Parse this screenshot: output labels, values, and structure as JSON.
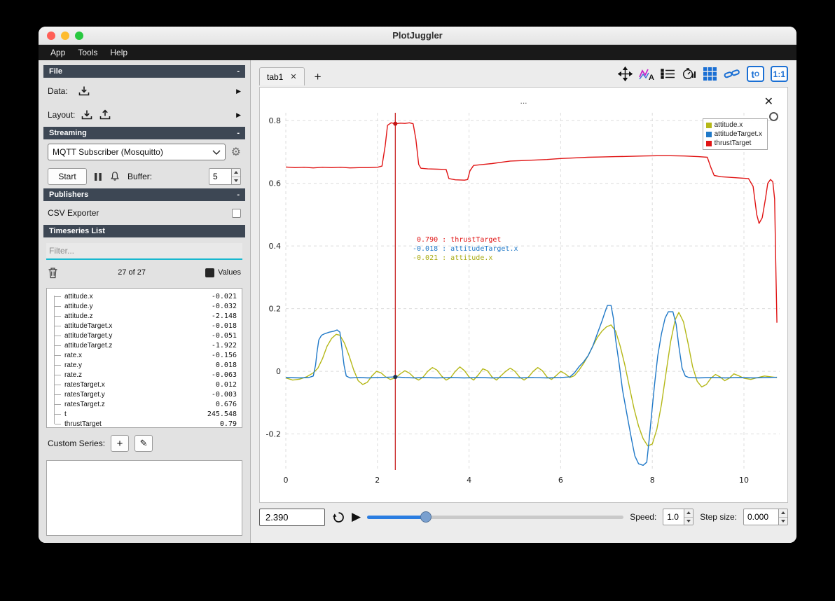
{
  "window": {
    "title": "PlotJuggler",
    "menu": [
      "App",
      "Tools",
      "Help"
    ]
  },
  "glyphs": {
    "arrow_right": "▶",
    "play": "▶",
    "plus": "+",
    "pencil": "✎",
    "gear": "⚙",
    "close": "✕",
    "collapse": "-"
  },
  "sidebar": {
    "file": {
      "header": "File",
      "collapse": "-",
      "data_label": "Data:",
      "layout_label": "Layout:"
    },
    "streaming": {
      "header": "Streaming",
      "collapse": "-",
      "source_selected": "MQTT Subscriber (Mosquitto)",
      "start_label": "Start",
      "buffer_label": "Buffer:",
      "buffer_value": "5"
    },
    "publishers": {
      "header": "Publishers",
      "collapse": "-",
      "csv_exporter_label": "CSV Exporter"
    },
    "timeseries": {
      "header": "Timeseries List",
      "filter_placeholder": "Filter...",
      "count": "27 of 27",
      "values_label": "Values",
      "items": [
        {
          "name": "attitude.x",
          "value": "-0.021"
        },
        {
          "name": "attitude.y",
          "value": "-0.032"
        },
        {
          "name": "attitude.z",
          "value": "-2.148"
        },
        {
          "name": "attitudeTarget.x",
          "value": "-0.018"
        },
        {
          "name": "attitudeTarget.y",
          "value": "-0.051"
        },
        {
          "name": "attitudeTarget.z",
          "value": "-1.922"
        },
        {
          "name": "rate.x",
          "value": "-0.156"
        },
        {
          "name": "rate.y",
          "value": "0.018"
        },
        {
          "name": "rate.z",
          "value": "-0.063"
        },
        {
          "name": "ratesTarget.x",
          "value": "0.012"
        },
        {
          "name": "ratesTarget.y",
          "value": "-0.003"
        },
        {
          "name": "ratesTarget.z",
          "value": "0.676"
        },
        {
          "name": "t",
          "value": "245.548"
        },
        {
          "name": "thrustTarget",
          "value": "0.79"
        }
      ],
      "custom_series_label": "Custom Series:"
    }
  },
  "main": {
    "tab": {
      "label": "tab1",
      "close": "✕",
      "add": "+"
    },
    "toolbar": {
      "time_offset_t": "t",
      "time_offset_sub": "O",
      "ratio_label": "1:1"
    },
    "plot": {
      "title": "...",
      "close": "✕",
      "legend": [
        {
          "label": "attitude.x",
          "color": "#b5b818"
        },
        {
          "label": "attitudeTarget.x",
          "color": "#2079c8"
        },
        {
          "label": "thrustTarget",
          "color": "#e01414"
        }
      ],
      "annotation": [
        {
          "value": " 0.790",
          "name": "thrustTarget",
          "color": "#e01414"
        },
        {
          "value": "-0.018",
          "name": "attitudeTarget.x",
          "color": "#2079c8"
        },
        {
          "value": "-0.021",
          "name": "attitude.x",
          "color": "#a9ab12"
        }
      ]
    },
    "playback": {
      "time": "2.390",
      "speed_label": "Speed:",
      "speed_value": "1.0",
      "step_label": "Step size:",
      "step_value": "0.000",
      "slider_percent": 23
    }
  },
  "chart_data": {
    "type": "line",
    "xlim": [
      0,
      10.78
    ],
    "ylim": [
      -0.315,
      0.825
    ],
    "x_ticks": [
      {
        "v": 0,
        "label": "0"
      },
      {
        "v": 2,
        "label": "2"
      },
      {
        "v": 4,
        "label": "4"
      },
      {
        "v": 6,
        "label": "6"
      },
      {
        "v": 8,
        "label": "8"
      },
      {
        "v": 10,
        "label": "10"
      }
    ],
    "y_ticks": [
      {
        "v": -0.2,
        "label": "-0.2"
      },
      {
        "v": 0,
        "label": "0"
      },
      {
        "v": 0.2,
        "label": "0.2"
      },
      {
        "v": 0.4,
        "label": "0.4"
      },
      {
        "v": 0.6,
        "label": "0.6"
      },
      {
        "v": 0.8,
        "label": "0.8"
      }
    ],
    "tracker_x": 2.39,
    "tracker_points": [
      {
        "y": 0.79,
        "color": "#c41414"
      },
      {
        "y": -0.018,
        "color": "#1b3350"
      }
    ],
    "series": [
      {
        "name": "attitude.x",
        "color": "#b5b818",
        "points": [
          [
            0,
            -0.021
          ],
          [
            0.15,
            -0.028
          ],
          [
            0.3,
            -0.025
          ],
          [
            0.45,
            -0.018
          ],
          [
            0.6,
            -0.005
          ],
          [
            0.7,
            0.01
          ],
          [
            0.8,
            0.04
          ],
          [
            0.9,
            0.08
          ],
          [
            1.0,
            0.105
          ],
          [
            1.1,
            0.118
          ],
          [
            1.18,
            0.115
          ],
          [
            1.28,
            0.09
          ],
          [
            1.38,
            0.05
          ],
          [
            1.48,
            0.005
          ],
          [
            1.58,
            -0.03
          ],
          [
            1.68,
            -0.042
          ],
          [
            1.78,
            -0.035
          ],
          [
            1.88,
            -0.015
          ],
          [
            1.98,
            0.0
          ],
          [
            2.08,
            -0.005
          ],
          [
            2.18,
            -0.018
          ],
          [
            2.28,
            -0.026
          ],
          [
            2.39,
            -0.021
          ],
          [
            2.5,
            -0.008
          ],
          [
            2.6,
            0.002
          ],
          [
            2.7,
            -0.006
          ],
          [
            2.8,
            -0.02
          ],
          [
            2.9,
            -0.028
          ],
          [
            3.0,
            -0.018
          ],
          [
            3.1,
            0.0
          ],
          [
            3.2,
            0.012
          ],
          [
            3.3,
            0.004
          ],
          [
            3.4,
            -0.015
          ],
          [
            3.5,
            -0.028
          ],
          [
            3.6,
            -0.02
          ],
          [
            3.7,
            0.0
          ],
          [
            3.8,
            0.014
          ],
          [
            3.9,
            0.002
          ],
          [
            4.0,
            -0.018
          ],
          [
            4.1,
            -0.028
          ],
          [
            4.2,
            -0.012
          ],
          [
            4.3,
            0.008
          ],
          [
            4.4,
            0.002
          ],
          [
            4.5,
            -0.018
          ],
          [
            4.6,
            -0.028
          ],
          [
            4.7,
            -0.014
          ],
          [
            4.8,
            0.0
          ],
          [
            4.9,
            0.01
          ],
          [
            5.0,
            0.0
          ],
          [
            5.1,
            -0.018
          ],
          [
            5.2,
            -0.028
          ],
          [
            5.3,
            -0.018
          ],
          [
            5.4,
            0.0
          ],
          [
            5.5,
            0.012
          ],
          [
            5.6,
            0.002
          ],
          [
            5.7,
            -0.018
          ],
          [
            5.8,
            -0.026
          ],
          [
            5.9,
            -0.014
          ],
          [
            6.0,
            0.0
          ],
          [
            6.1,
            -0.008
          ],
          [
            6.2,
            -0.02
          ],
          [
            6.3,
            -0.014
          ],
          [
            6.4,
            0.004
          ],
          [
            6.5,
            0.025
          ],
          [
            6.6,
            0.05
          ],
          [
            6.7,
            0.08
          ],
          [
            6.8,
            0.108
          ],
          [
            6.9,
            0.128
          ],
          [
            7.0,
            0.142
          ],
          [
            7.1,
            0.148
          ],
          [
            7.2,
            0.128
          ],
          [
            7.3,
            0.08
          ],
          [
            7.4,
            0.02
          ],
          [
            7.5,
            -0.05
          ],
          [
            7.6,
            -0.118
          ],
          [
            7.7,
            -0.175
          ],
          [
            7.8,
            -0.215
          ],
          [
            7.9,
            -0.238
          ],
          [
            8.0,
            -0.232
          ],
          [
            8.1,
            -0.185
          ],
          [
            8.2,
            -0.105
          ],
          [
            8.3,
            -0.005
          ],
          [
            8.4,
            0.095
          ],
          [
            8.5,
            0.165
          ],
          [
            8.58,
            0.188
          ],
          [
            8.68,
            0.158
          ],
          [
            8.78,
            0.09
          ],
          [
            8.88,
            0.015
          ],
          [
            8.98,
            -0.032
          ],
          [
            9.08,
            -0.05
          ],
          [
            9.18,
            -0.042
          ],
          [
            9.28,
            -0.022
          ],
          [
            9.38,
            -0.01
          ],
          [
            9.48,
            -0.018
          ],
          [
            9.58,
            -0.03
          ],
          [
            9.68,
            -0.022
          ],
          [
            9.78,
            -0.008
          ],
          [
            9.88,
            -0.014
          ],
          [
            10.0,
            -0.022
          ],
          [
            10.15,
            -0.026
          ],
          [
            10.3,
            -0.02
          ],
          [
            10.45,
            -0.015
          ],
          [
            10.6,
            -0.018
          ],
          [
            10.72,
            -0.02
          ]
        ]
      },
      {
        "name": "attitudeTarget.x",
        "color": "#2079c8",
        "points": [
          [
            0,
            -0.02
          ],
          [
            0.3,
            -0.021
          ],
          [
            0.5,
            -0.02
          ],
          [
            0.6,
            -0.015
          ],
          [
            0.65,
            0.02
          ],
          [
            0.68,
            0.06
          ],
          [
            0.72,
            0.1
          ],
          [
            0.78,
            0.115
          ],
          [
            0.85,
            0.12
          ],
          [
            0.95,
            0.125
          ],
          [
            1.05,
            0.128
          ],
          [
            1.12,
            0.132
          ],
          [
            1.18,
            0.125
          ],
          [
            1.22,
            0.08
          ],
          [
            1.27,
            0.02
          ],
          [
            1.32,
            -0.015
          ],
          [
            1.4,
            -0.021
          ],
          [
            1.6,
            -0.02
          ],
          [
            1.8,
            -0.021
          ],
          [
            2.0,
            -0.02
          ],
          [
            2.2,
            -0.019
          ],
          [
            2.39,
            -0.018
          ],
          [
            2.6,
            -0.02
          ],
          [
            2.8,
            -0.021
          ],
          [
            3.0,
            -0.02
          ],
          [
            3.3,
            -0.021
          ],
          [
            3.6,
            -0.02
          ],
          [
            3.9,
            -0.021
          ],
          [
            4.2,
            -0.02
          ],
          [
            4.5,
            -0.021
          ],
          [
            4.8,
            -0.02
          ],
          [
            5.1,
            -0.021
          ],
          [
            5.4,
            -0.02
          ],
          [
            5.7,
            -0.021
          ],
          [
            6.0,
            -0.02
          ],
          [
            6.2,
            -0.018
          ],
          [
            6.3,
            -0.005
          ],
          [
            6.4,
            0.015
          ],
          [
            6.5,
            0.03
          ],
          [
            6.6,
            0.05
          ],
          [
            6.7,
            0.08
          ],
          [
            6.8,
            0.12
          ],
          [
            6.9,
            0.16
          ],
          [
            6.97,
            0.19
          ],
          [
            7.02,
            0.21
          ],
          [
            7.1,
            0.21
          ],
          [
            7.15,
            0.17
          ],
          [
            7.2,
            0.1
          ],
          [
            7.28,
            0.02
          ],
          [
            7.35,
            -0.06
          ],
          [
            7.45,
            -0.14
          ],
          [
            7.55,
            -0.22
          ],
          [
            7.62,
            -0.27
          ],
          [
            7.7,
            -0.295
          ],
          [
            7.8,
            -0.3
          ],
          [
            7.88,
            -0.29
          ],
          [
            7.93,
            -0.22
          ],
          [
            7.99,
            -0.13
          ],
          [
            8.05,
            -0.04
          ],
          [
            8.12,
            0.05
          ],
          [
            8.2,
            0.12
          ],
          [
            8.28,
            0.17
          ],
          [
            8.35,
            0.19
          ],
          [
            8.45,
            0.19
          ],
          [
            8.52,
            0.15
          ],
          [
            8.58,
            0.08
          ],
          [
            8.65,
            0.01
          ],
          [
            8.72,
            -0.015
          ],
          [
            8.8,
            -0.02
          ],
          [
            9.0,
            -0.021
          ],
          [
            9.3,
            -0.02
          ],
          [
            9.6,
            -0.021
          ],
          [
            9.9,
            -0.02
          ],
          [
            10.2,
            -0.021
          ],
          [
            10.5,
            -0.02
          ],
          [
            10.72,
            -0.019
          ]
        ]
      },
      {
        "name": "thrustTarget",
        "color": "#e01414",
        "points": [
          [
            0,
            0.652
          ],
          [
            0.2,
            0.65
          ],
          [
            0.4,
            0.651
          ],
          [
            0.6,
            0.649
          ],
          [
            0.8,
            0.651
          ],
          [
            1.0,
            0.65
          ],
          [
            1.2,
            0.651
          ],
          [
            1.4,
            0.649
          ],
          [
            1.6,
            0.65
          ],
          [
            1.8,
            0.65
          ],
          [
            2.0,
            0.651
          ],
          [
            2.1,
            0.655
          ],
          [
            2.17,
            0.72
          ],
          [
            2.22,
            0.785
          ],
          [
            2.3,
            0.793
          ],
          [
            2.39,
            0.79
          ],
          [
            2.5,
            0.792
          ],
          [
            2.6,
            0.791
          ],
          [
            2.7,
            0.793
          ],
          [
            2.78,
            0.79
          ],
          [
            2.84,
            0.74
          ],
          [
            2.9,
            0.66
          ],
          [
            2.95,
            0.648
          ],
          [
            3.1,
            0.646
          ],
          [
            3.3,
            0.645
          ],
          [
            3.5,
            0.644
          ],
          [
            3.56,
            0.615
          ],
          [
            3.7,
            0.611
          ],
          [
            3.9,
            0.61
          ],
          [
            3.97,
            0.612
          ],
          [
            4.02,
            0.64
          ],
          [
            4.1,
            0.657
          ],
          [
            4.3,
            0.66
          ],
          [
            4.5,
            0.663
          ],
          [
            4.7,
            0.667
          ],
          [
            4.9,
            0.671
          ],
          [
            5.1,
            0.672
          ],
          [
            5.4,
            0.674
          ],
          [
            5.7,
            0.676
          ],
          [
            6.0,
            0.679
          ],
          [
            6.3,
            0.681
          ],
          [
            6.6,
            0.683
          ],
          [
            6.9,
            0.684
          ],
          [
            7.2,
            0.685
          ],
          [
            7.5,
            0.686
          ],
          [
            7.8,
            0.687
          ],
          [
            8.1,
            0.688
          ],
          [
            8.4,
            0.688
          ],
          [
            8.7,
            0.687
          ],
          [
            9.0,
            0.685
          ],
          [
            9.2,
            0.683
          ],
          [
            9.28,
            0.65
          ],
          [
            9.35,
            0.625
          ],
          [
            9.5,
            0.621
          ],
          [
            9.7,
            0.619
          ],
          [
            9.9,
            0.617
          ],
          [
            10.1,
            0.615
          ],
          [
            10.2,
            0.59
          ],
          [
            10.28,
            0.5
          ],
          [
            10.33,
            0.472
          ],
          [
            10.4,
            0.49
          ],
          [
            10.47,
            0.55
          ],
          [
            10.52,
            0.6
          ],
          [
            10.58,
            0.612
          ],
          [
            10.63,
            0.605
          ],
          [
            10.67,
            0.55
          ],
          [
            10.7,
            0.3
          ],
          [
            10.72,
            0.155
          ]
        ]
      }
    ]
  }
}
